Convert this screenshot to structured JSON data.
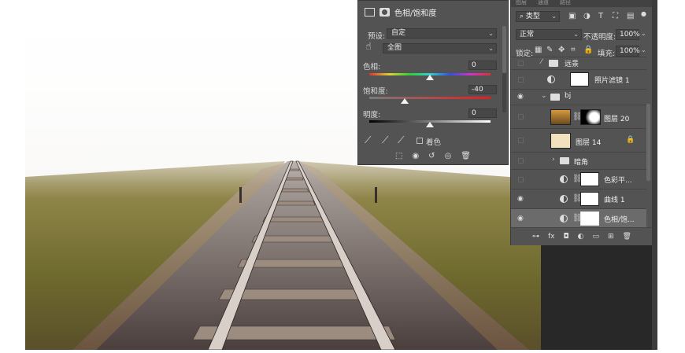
{
  "properties": {
    "title": "色相/饱和度",
    "preset_label": "预设:",
    "preset_value": "自定",
    "range_value": "全图",
    "hue_label": "色相:",
    "hue_value": "0",
    "saturation_label": "饱和度:",
    "saturation_value": "-40",
    "lightness_label": "明度:",
    "lightness_value": "0",
    "colorize_label": "着色"
  },
  "layers": {
    "tabs": [
      "图层",
      "通道",
      "路径"
    ],
    "filter_kind": "类型",
    "blend_mode": "正常",
    "opacity_label": "不透明度:",
    "opacity_value": "100%",
    "lock_label": "锁定:",
    "fill_label": "填充:",
    "fill_value": "100%",
    "items": [
      {
        "name": "远景",
        "visible": false
      },
      {
        "name": "照片滤镜 1",
        "visible": false
      },
      {
        "name": "bj",
        "visible": true
      },
      {
        "name": "图层 20",
        "visible": false
      },
      {
        "name": "图层 14",
        "visible": false
      },
      {
        "name": "暗角",
        "visible": false
      },
      {
        "name": "色彩平...",
        "visible": false
      },
      {
        "name": "曲线 1",
        "visible": true
      },
      {
        "name": "色相/饱...",
        "visible": true
      }
    ]
  },
  "icons": [
    "eye-icon",
    "folder-icon",
    "link-icon",
    "lock-icon",
    "eyedropper-icon",
    "trash-icon",
    "fx-icon",
    "mask-icon",
    "new-layer-icon",
    "new-group-icon",
    "adjustment-icon"
  ]
}
